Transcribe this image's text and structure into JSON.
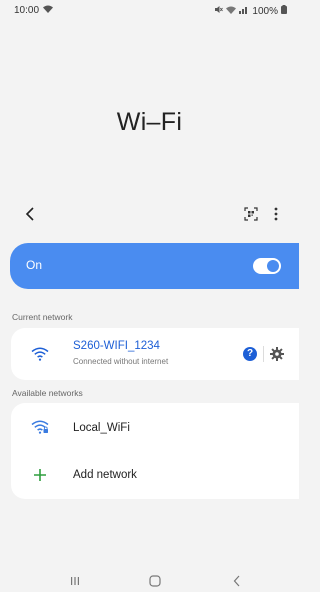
{
  "status_bar": {
    "time": "10:00",
    "battery": "100%"
  },
  "page": {
    "title": "Wi–Fi"
  },
  "toolbar": {
    "back_icon": "chevron-left-icon",
    "qr_icon": "qr-scan-icon",
    "more_icon": "more-vert-icon"
  },
  "wifi_switch": {
    "label": "On",
    "state": "on"
  },
  "current_network": {
    "header": "Current network",
    "name": "S260-WIFI_1234",
    "status": "Connected without internet",
    "name_color": "#1d5fd6"
  },
  "available_networks": {
    "header": "Available networks",
    "items": [
      {
        "name": "Local_WiFi",
        "secured": true
      }
    ],
    "add_label": "Add network"
  },
  "colors": {
    "accent": "#4a8cf0",
    "add_icon": "#2e9e3e"
  }
}
